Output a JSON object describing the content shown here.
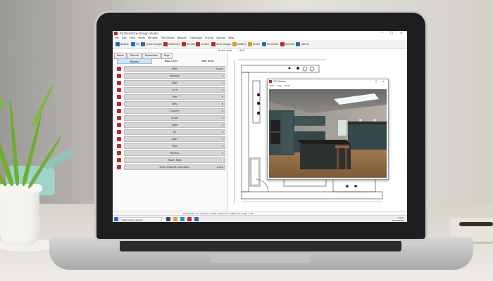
{
  "app": {
    "title": "KitchenDraw Design Studio",
    "window_controls": "– □ ×"
  },
  "menu": [
    "File",
    "Edit",
    "View",
    "Mode",
    "Window",
    "The Design",
    "Reports",
    "Catalogue",
    "Pricing",
    "Special",
    "Help"
  ],
  "toolbar": {
    "items": [
      {
        "label": "Basket",
        "color": "#2b6cb0"
      },
      {
        "label": "Fill",
        "color": "#2b6cb0"
      },
      {
        "label": "Quick Design",
        "color": "#2b6cb0"
      },
      {
        "label": "Materials",
        "color": "#c0282d"
      },
      {
        "label": "Render",
        "color": "#c0282d"
      },
      {
        "label": "Create",
        "color": "#c0282d"
      },
      {
        "label": "Save Image",
        "color": "#c0282d"
      },
      {
        "label": "Gallery",
        "color": "#d9a21b"
      },
      {
        "label": "Share",
        "color": "#d9a21b"
      },
      {
        "label": "Fly Mode",
        "color": "#2b6cb0"
      },
      {
        "label": "Specify",
        "color": "#c0282d"
      },
      {
        "label": "Library",
        "color": "#2b6cb0"
      }
    ]
  },
  "viewbar": {
    "scale_label": "Scale units",
    "zoom": "90%"
  },
  "panel": {
    "tabs": [
      "Items",
      "Search",
      "Favourites",
      "Tags"
    ],
    "subtabs": [
      "Rooms",
      "Base Units",
      "Wall Units"
    ],
    "rows": [
      {
        "label": "Wall",
        "right": "Height"
      },
      {
        "label": "Window",
        "right": "8"
      },
      {
        "label": "Door",
        "right": "8"
      },
      {
        "label": "Arch",
        "right": "8"
      },
      {
        "label": "Pier",
        "right": "8"
      },
      {
        "label": "Bay",
        "right": "8"
      },
      {
        "label": "Column",
        "right": "8"
      },
      {
        "label": "Stairs",
        "right": "8"
      },
      {
        "label": "Light",
        "right": "8"
      },
      {
        "label": "Air",
        "right": "8"
      },
      {
        "label": "Duct",
        "right": "8"
      },
      {
        "label": "Pipe",
        "right": "8"
      },
      {
        "label": "Recess",
        "right": "8"
      },
      {
        "label": "Room Hole",
        "right": ""
      },
      {
        "label": "Filing Fixtures and Doors",
        "right": "Profile"
      }
    ]
  },
  "status": "Horizontal = 0, Vertical = 2480, Distance = 2480 mm, Angle = 90°",
  "taskbar": {
    "search_placeholder": "Type here to search",
    "time": "09:11",
    "date": "01/06/2022"
  },
  "viewer": {
    "title": "3D Viewer",
    "menu": [
      "Edit",
      "View",
      "Mode"
    ]
  }
}
